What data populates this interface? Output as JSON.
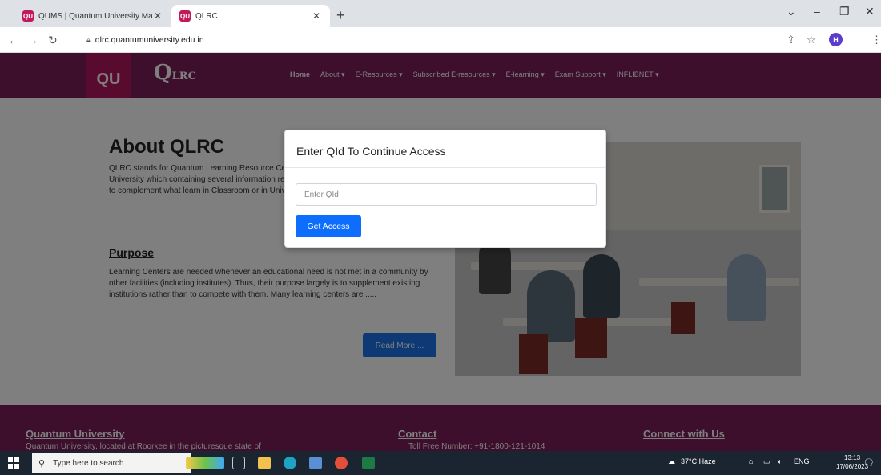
{
  "browser": {
    "tabs": [
      {
        "title": "QUMS | Quantum University Ma...",
        "favicon": "QU"
      },
      {
        "title": "QLRC",
        "favicon": "QU"
      }
    ],
    "new_tab": "+",
    "url": "qlrc.quantumuniversity.edu.in",
    "profile_initial": "H"
  },
  "site": {
    "logo_mark": "QU",
    "logo_q": "Q",
    "logo_lrc": "LRC",
    "menu": [
      "Home",
      "About ▾",
      "E-Resources ▾",
      "Subscribed E-resources ▾",
      "E-learning ▾",
      "Exam Support ▾",
      "INFLIBNET ▾"
    ],
    "about_title": "About QLRC",
    "about_text": "QLRC stands for Quantum Learning Resource Centre is a facility with in the Quantum University which containing several information resources as supplemental educational tool to complement what learn in Classroom or in University.",
    "purpose_title": "Purpose",
    "purpose_text": "Learning Centers are needed whenever an educational need is not met in a community by other facilities (including institutes). Thus, their purpose largely is to supplement existing institutions rather than to compete with them. Many learning centers are .....",
    "read_more": "Read More ...",
    "footer": {
      "col1_title": "Quantum University",
      "col1_text": "Quantum University, located at Roorkee in the picturesque state of",
      "col2_title": "Contact",
      "col2_text": "Toll Free Number: +91-1800-121-1014",
      "col3_title": "Connect with Us"
    }
  },
  "modal": {
    "title": "Enter QId To Continue Access",
    "input_placeholder": "Enter QId",
    "input_value": "",
    "button_label": "Get Access"
  },
  "taskbar": {
    "search_placeholder": "Type here to search",
    "weather": "37°C Haze",
    "language": "ENG",
    "time": "13:13",
    "date": "17/06/2023"
  },
  "colors": {
    "brand": "#7b1e58",
    "primary_button": "#0d6efd"
  }
}
